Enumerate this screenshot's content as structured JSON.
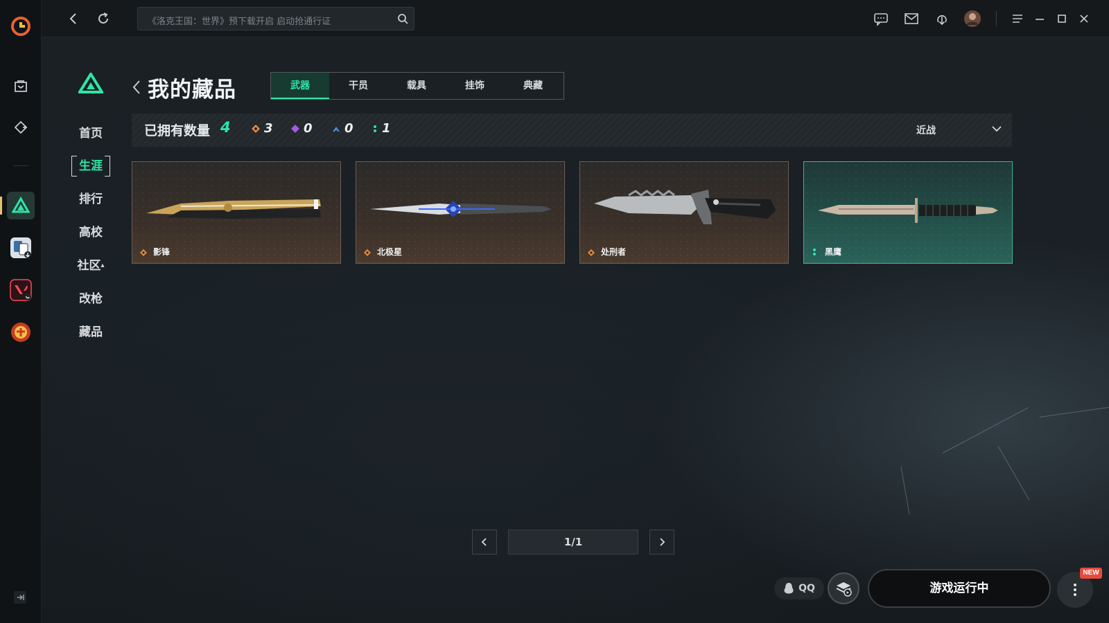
{
  "search": {
    "placeholder": "《洛克王国：世界》预下载开启 启动抢通行证"
  },
  "nav": {
    "items": [
      {
        "label": "首页"
      },
      {
        "label": "生涯"
      },
      {
        "label": "排行"
      },
      {
        "label": "高校"
      },
      {
        "label": "社区"
      },
      {
        "label": "改枪"
      },
      {
        "label": "藏品"
      }
    ]
  },
  "header": {
    "title": "我的藏品"
  },
  "tabs": [
    {
      "label": "武器"
    },
    {
      "label": "干员"
    },
    {
      "label": "载具"
    },
    {
      "label": "挂饰"
    },
    {
      "label": "典藏"
    }
  ],
  "stats": {
    "label": "已拥有数量",
    "total": "4",
    "rarities": [
      {
        "icon": "orange-diamond-icon",
        "color": "#e38a3c",
        "count": "3"
      },
      {
        "icon": "purple-diamond-icon",
        "color": "#a35be0",
        "count": "0"
      },
      {
        "icon": "blue-chevron-icon",
        "color": "#4f8fe0",
        "count": "0"
      },
      {
        "icon": "green-dots-icon",
        "color": "#2ee6a6",
        "count": "1"
      }
    ],
    "filter": "近战"
  },
  "cards": [
    {
      "name": "影锋",
      "rarity_icon": "orange-diamond-icon"
    },
    {
      "name": "北极星",
      "rarity_icon": "orange-diamond-icon"
    },
    {
      "name": "处刑者",
      "rarity_icon": "orange-diamond-icon"
    },
    {
      "name": "黑鹰",
      "rarity_icon": "green-dots-icon"
    }
  ],
  "pagination": {
    "text": "1/1"
  },
  "bottom": {
    "qq_label": "QQ",
    "run_label": "游戏运行中",
    "new_badge": "NEW"
  },
  "colors": {
    "accent": "#2ee6a6",
    "rare_orange": "#e38a3c",
    "teal_card": "#3fb59a"
  }
}
